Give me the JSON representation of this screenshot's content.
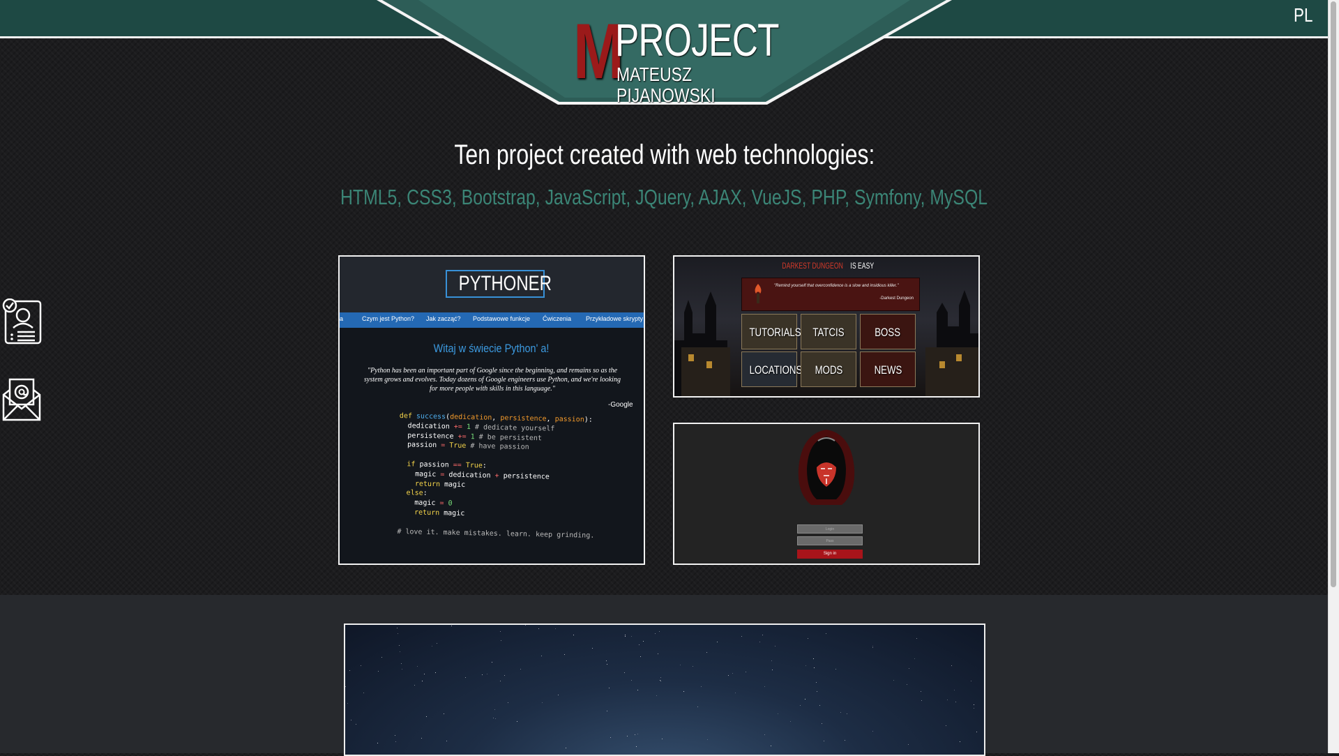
{
  "header": {
    "logo_initial": "M",
    "logo_word": "PROJECT",
    "logo_subtitle": "MATEUSZ PIJANOWSKI",
    "language_toggle": "PL",
    "colors": {
      "teal": "#1e4944",
      "logo_red": "#9b1a1a"
    }
  },
  "side_icons": [
    {
      "name": "cv-document-icon"
    },
    {
      "name": "contact-mail-icon"
    }
  ],
  "intro": {
    "heading": "Ten project created with web technologies:",
    "technologies": "HTML5, CSS3, Bootstrap, JavaScript, JQuery, AJAX, VueJS, PHP, Symfony, MySQL",
    "accent_color": "#3b8576"
  },
  "projects": {
    "python": {
      "title": "PYTHONER",
      "nav": [
        "a",
        "Czym jest Python?",
        "Jak zacząć?",
        "Podstawowe funkcje",
        "Ćwiczenia",
        "Przykładowe skrypty"
      ],
      "welcome": "Witaj w świecie Python' a!",
      "quote": "\"Python has been an important part of Google since the beginning, and remains so as the system grows and evolves. Today dozens of Google engineers use Python, and we're looking for more people with skills in this language.\"",
      "quote_author": "-Google",
      "code_comment": "# love it. make mistakes. learn. keep grinding."
    },
    "darkest_dungeon": {
      "title_red": "DARKEST DUNGEON",
      "title_white": " IS EASY",
      "quote": "\"Remind yourself that overconfidence is a slow and insidious killer.\"",
      "quote_author": "-Darkest Dungeon",
      "buttons": [
        "TUTORIALS",
        "TATCIS",
        "BOSS",
        "LOCATIONS",
        "MODS",
        "NEWS"
      ]
    },
    "login": {
      "login_placeholder": "Login",
      "password_placeholder": "Pass",
      "sign_in": "Sign in"
    }
  }
}
